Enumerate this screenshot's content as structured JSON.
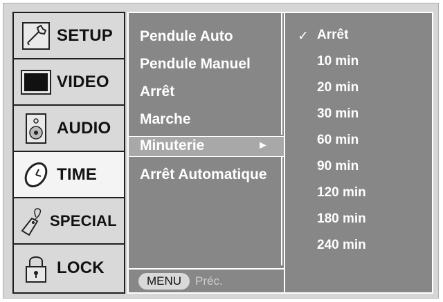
{
  "tabs": [
    {
      "label": "SETUP",
      "icon": "wrench-icon"
    },
    {
      "label": "VIDEO",
      "icon": "screen-icon"
    },
    {
      "label": "AUDIO",
      "icon": "speaker-icon"
    },
    {
      "label": "TIME",
      "icon": "clock-icon"
    },
    {
      "label": "SPECIAL",
      "icon": "tag-icon"
    },
    {
      "label": "LOCK",
      "icon": "padlock-icon"
    }
  ],
  "active_tab": "TIME",
  "submenu": {
    "items": [
      "Pendule Auto",
      "Pendule Manuel",
      "Arrêt",
      "Marche"
    ],
    "highlighted": "Minuterie",
    "highlight_arrow": "►",
    "after": "Arrêt Automatique"
  },
  "footer": {
    "menu_label": "MENU",
    "back_label": "Préc."
  },
  "options": {
    "checkmark": "✓",
    "items": [
      "Arrêt",
      "10 min",
      "20 min",
      "30 min",
      "60 min",
      "90 min",
      "120 min",
      "180 min",
      "240 min"
    ],
    "selected": "Arrêt"
  },
  "colors": {
    "panel_gray": "#878787",
    "tab_gray": "#d9d9d9",
    "active_tab": "#f4f4f4",
    "highlight": "#a8a8a8",
    "text": "#ffffff"
  }
}
